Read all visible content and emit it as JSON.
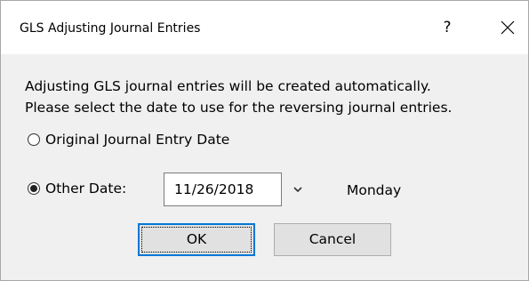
{
  "window": {
    "title": "GLS Adjusting Journal Entries",
    "help_label": "?",
    "close_icon": "close-icon"
  },
  "message": {
    "line1": "Adjusting GLS journal entries will be created automatically.",
    "line2": "Please select the date to use for the reversing journal entries."
  },
  "options": {
    "original": {
      "label": "Original Journal Entry Date",
      "checked": false
    },
    "other": {
      "label": "Other Date:",
      "checked": true
    }
  },
  "date": {
    "value": "11/26/2018",
    "weekday": "Monday",
    "dropdown_icon": "chevron-down-icon"
  },
  "buttons": {
    "ok_label": "OK",
    "cancel_label": "Cancel"
  },
  "colors": {
    "titlebar_bg": "#ffffff",
    "body_bg": "#f0f0f0",
    "button_bg": "#e1e1e1",
    "focus_border": "#0078d7"
  }
}
